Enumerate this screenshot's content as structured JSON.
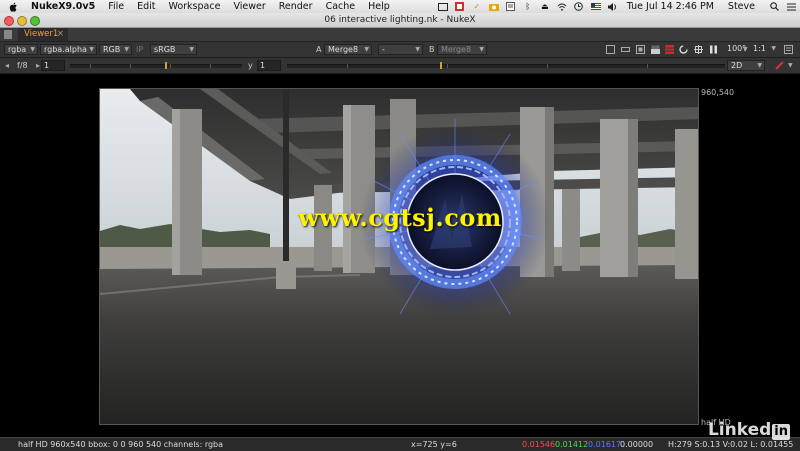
{
  "menubar": {
    "items": [
      "NukeX9.0v5",
      "File",
      "Edit",
      "Workspace",
      "Viewer",
      "Render",
      "Cache",
      "Help"
    ],
    "clock": "Tue Jul 14  2:46 PM",
    "user": "Steve"
  },
  "window": {
    "title": "06 interactive lighting.nk - NukeX"
  },
  "tabs": [
    {
      "label": "Viewer1"
    }
  ],
  "viewer_controls": {
    "channels": "rgba",
    "alpha_channel": "rgba.alpha",
    "display": "RGB",
    "ip": "IP",
    "lut": "sRGB",
    "a_label": "A",
    "a_input": "Merge8",
    "compare_mode": "-",
    "b_label": "B",
    "b_input": "Merge8",
    "zoom": "100%",
    "proxy_ratio": "1:1",
    "view_mode": "2D"
  },
  "frame_controls": {
    "fstop": "f/8",
    "gain": "1",
    "gamma_label": "y",
    "gamma": "1",
    "gain_mark_fraction": 0.55,
    "gamma_mark_fraction": 0.35
  },
  "viewport": {
    "format_top_right": "960,540",
    "format_bottom_right": "half HD"
  },
  "watermark": "www.cgtsj.com",
  "status": {
    "format": "half HD 960x540  bbox: 0 0 960 540 channels: rgba",
    "coords": "x=725 y=6",
    "r": "0.01546",
    "g": "0.01412",
    "b": "0.01617",
    "a": "0.00000",
    "hsv": "H:279 S:0.13 V:0.02  L: 0.01455"
  },
  "colors": {
    "viewer_tab": "#f0a030",
    "status_r": "#ff4a4a",
    "status_g": "#4adc4a",
    "status_b": "#5a7aff",
    "portal_glow": "#2a55ff"
  },
  "brand": "Linked"
}
